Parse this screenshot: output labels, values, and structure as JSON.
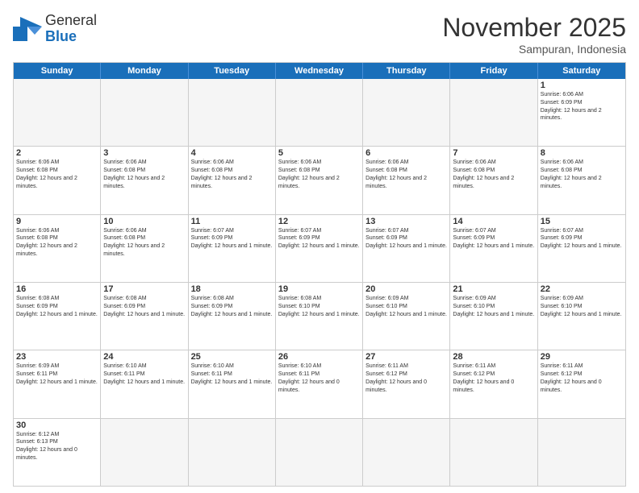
{
  "logo": {
    "text_general": "General",
    "text_blue": "Blue"
  },
  "title": "November 2025",
  "subtitle": "Sampuran, Indonesia",
  "weekdays": [
    "Sunday",
    "Monday",
    "Tuesday",
    "Wednesday",
    "Thursday",
    "Friday",
    "Saturday"
  ],
  "weeks": [
    [
      {
        "day": "",
        "empty": true
      },
      {
        "day": "",
        "empty": true
      },
      {
        "day": "",
        "empty": true
      },
      {
        "day": "",
        "empty": true
      },
      {
        "day": "",
        "empty": true
      },
      {
        "day": "",
        "empty": true
      },
      {
        "day": "1",
        "sunrise": "6:06 AM",
        "sunset": "6:09 PM",
        "daylight": "12 hours and 2 minutes."
      }
    ],
    [
      {
        "day": "2",
        "sunrise": "6:06 AM",
        "sunset": "6:08 PM",
        "daylight": "12 hours and 2 minutes."
      },
      {
        "day": "3",
        "sunrise": "6:06 AM",
        "sunset": "6:08 PM",
        "daylight": "12 hours and 2 minutes."
      },
      {
        "day": "4",
        "sunrise": "6:06 AM",
        "sunset": "6:08 PM",
        "daylight": "12 hours and 2 minutes."
      },
      {
        "day": "5",
        "sunrise": "6:06 AM",
        "sunset": "6:08 PM",
        "daylight": "12 hours and 2 minutes."
      },
      {
        "day": "6",
        "sunrise": "6:06 AM",
        "sunset": "6:08 PM",
        "daylight": "12 hours and 2 minutes."
      },
      {
        "day": "7",
        "sunrise": "6:06 AM",
        "sunset": "6:08 PM",
        "daylight": "12 hours and 2 minutes."
      },
      {
        "day": "8",
        "sunrise": "6:06 AM",
        "sunset": "6:08 PM",
        "daylight": "12 hours and 2 minutes."
      }
    ],
    [
      {
        "day": "9",
        "sunrise": "6:06 AM",
        "sunset": "6:08 PM",
        "daylight": "12 hours and 2 minutes."
      },
      {
        "day": "10",
        "sunrise": "6:06 AM",
        "sunset": "6:08 PM",
        "daylight": "12 hours and 2 minutes."
      },
      {
        "day": "11",
        "sunrise": "6:07 AM",
        "sunset": "6:09 PM",
        "daylight": "12 hours and 1 minute."
      },
      {
        "day": "12",
        "sunrise": "6:07 AM",
        "sunset": "6:09 PM",
        "daylight": "12 hours and 1 minute."
      },
      {
        "day": "13",
        "sunrise": "6:07 AM",
        "sunset": "6:09 PM",
        "daylight": "12 hours and 1 minute."
      },
      {
        "day": "14",
        "sunrise": "6:07 AM",
        "sunset": "6:09 PM",
        "daylight": "12 hours and 1 minute."
      },
      {
        "day": "15",
        "sunrise": "6:07 AM",
        "sunset": "6:09 PM",
        "daylight": "12 hours and 1 minute."
      }
    ],
    [
      {
        "day": "16",
        "sunrise": "6:08 AM",
        "sunset": "6:09 PM",
        "daylight": "12 hours and 1 minute."
      },
      {
        "day": "17",
        "sunrise": "6:08 AM",
        "sunset": "6:09 PM",
        "daylight": "12 hours and 1 minute."
      },
      {
        "day": "18",
        "sunrise": "6:08 AM",
        "sunset": "6:09 PM",
        "daylight": "12 hours and 1 minute."
      },
      {
        "day": "19",
        "sunrise": "6:08 AM",
        "sunset": "6:10 PM",
        "daylight": "12 hours and 1 minute."
      },
      {
        "day": "20",
        "sunrise": "6:09 AM",
        "sunset": "6:10 PM",
        "daylight": "12 hours and 1 minute."
      },
      {
        "day": "21",
        "sunrise": "6:09 AM",
        "sunset": "6:10 PM",
        "daylight": "12 hours and 1 minute."
      },
      {
        "day": "22",
        "sunrise": "6:09 AM",
        "sunset": "6:10 PM",
        "daylight": "12 hours and 1 minute."
      }
    ],
    [
      {
        "day": "23",
        "sunrise": "6:09 AM",
        "sunset": "6:11 PM",
        "daylight": "12 hours and 1 minute."
      },
      {
        "day": "24",
        "sunrise": "6:10 AM",
        "sunset": "6:11 PM",
        "daylight": "12 hours and 1 minute."
      },
      {
        "day": "25",
        "sunrise": "6:10 AM",
        "sunset": "6:11 PM",
        "daylight": "12 hours and 1 minute."
      },
      {
        "day": "26",
        "sunrise": "6:10 AM",
        "sunset": "6:11 PM",
        "daylight": "12 hours and 0 minutes."
      },
      {
        "day": "27",
        "sunrise": "6:11 AM",
        "sunset": "6:12 PM",
        "daylight": "12 hours and 0 minutes."
      },
      {
        "day": "28",
        "sunrise": "6:11 AM",
        "sunset": "6:12 PM",
        "daylight": "12 hours and 0 minutes."
      },
      {
        "day": "29",
        "sunrise": "6:11 AM",
        "sunset": "6:12 PM",
        "daylight": "12 hours and 0 minutes."
      }
    ],
    [
      {
        "day": "30",
        "sunrise": "6:12 AM",
        "sunset": "6:13 PM",
        "daylight": "12 hours and 0 minutes.",
        "hasData": true
      },
      {
        "day": "",
        "empty": true
      },
      {
        "day": "",
        "empty": true
      },
      {
        "day": "",
        "empty": true
      },
      {
        "day": "",
        "empty": true
      },
      {
        "day": "",
        "empty": true
      },
      {
        "day": "",
        "empty": true
      }
    ]
  ]
}
